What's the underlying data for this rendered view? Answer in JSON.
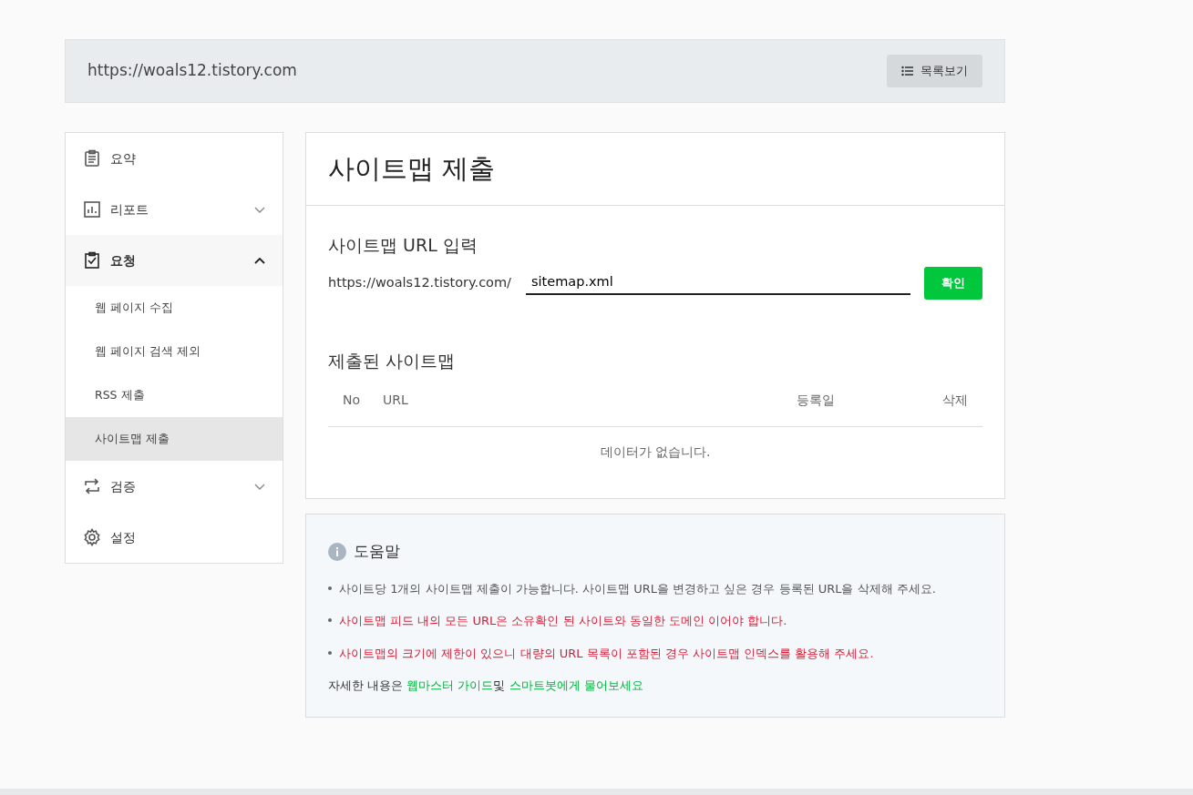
{
  "header": {
    "site_url": "https://woals12.tistory.com",
    "list_button": "목록보기"
  },
  "sidebar": {
    "items": [
      {
        "label": "요약",
        "selected": false
      },
      {
        "label": "리포트",
        "selected": false,
        "expanded": false
      },
      {
        "label": "요청",
        "selected": true,
        "expanded": true,
        "children": [
          {
            "label": "웹 페이지 수집",
            "selected": false
          },
          {
            "label": "웹 페이지 검색 제외",
            "selected": false
          },
          {
            "label": "RSS 제출",
            "selected": false
          },
          {
            "label": "사이트맵 제출",
            "selected": true
          }
        ]
      },
      {
        "label": "검증",
        "selected": false,
        "expanded": false
      },
      {
        "label": "설정",
        "selected": false
      }
    ]
  },
  "main": {
    "title": "사이트맵 제출",
    "input_section": {
      "heading": "사이트맵 URL 입력",
      "prefix": "https://woals12.tistory.com/",
      "value": "sitemap.xml",
      "button": "확인"
    },
    "submitted": {
      "heading": "제출된 사이트맵",
      "columns": [
        "No",
        "URL",
        "등록일",
        "삭제"
      ],
      "empty_message": "데이터가 없습니다."
    }
  },
  "help": {
    "title": "도움말",
    "items": [
      {
        "text": "사이트당 1개의 사이트맵 제출이 가능합니다. 사이트맵 URL을 변경하고 싶은 경우 등록된 URL을 삭제해 주세요.",
        "color": "#555555"
      },
      {
        "text": "사이트맵 피드 내의 모든 URL은 소유확인 된 사이트와 동일한 도메인 이어야 합니다.",
        "color": "#d6203a"
      },
      {
        "text": "사이트맵의 크기에 제한이 있으니 대량의 URL 목록이 포함된 경우 사이트맵 인덱스를 활용해 주세요.",
        "color": "#d6203a"
      }
    ],
    "footer": [
      {
        "kind": "text",
        "text": "자세한 내용은 "
      },
      {
        "kind": "link",
        "text": "웹마스터 가이드"
      },
      {
        "kind": "text",
        "text": "및 "
      },
      {
        "kind": "link",
        "text": "스마트봇에게 물어보세요"
      }
    ]
  }
}
